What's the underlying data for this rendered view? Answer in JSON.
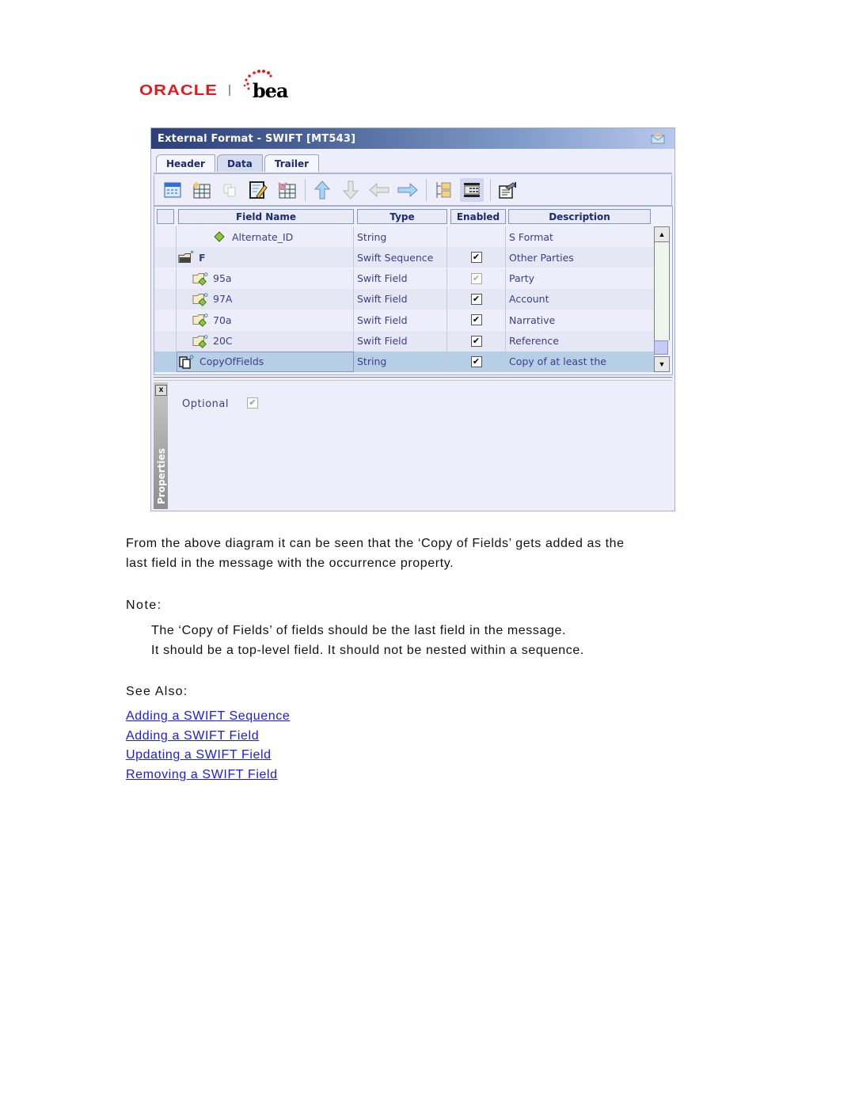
{
  "logo": {
    "oracle": "ORACLE",
    "bea": "bea"
  },
  "window": {
    "title": "External Format - SWIFT [MT543]",
    "tabs": [
      {
        "label": "Header",
        "active": false
      },
      {
        "label": "Data",
        "active": true
      },
      {
        "label": "Trailer",
        "active": false
      }
    ],
    "toolbar": [
      "properties-icon",
      "add-row-icon",
      "copy-icon",
      "edit-icon",
      "delete-row-icon",
      "move-up-icon",
      "move-down-icon",
      "move-left-icon",
      "move-right-icon",
      "tree-view-icon",
      "grid-view-icon",
      "settings-icon"
    ],
    "grid": {
      "columns": [
        "Field Name",
        "Type",
        "Enabled",
        "Description"
      ],
      "rows": [
        {
          "name": "Alternate_ID",
          "type": "String",
          "enabled": "",
          "description": "S Format",
          "icon": "diamond-icon",
          "indent": 2
        },
        {
          "name": "F",
          "type": "Swift Sequence",
          "enabled": "checked",
          "description": "Other Parties",
          "icon": "sequence-folder-icon",
          "indent": 0
        },
        {
          "name": "95a",
          "type": "Swift Field",
          "enabled": "disabled",
          "description": "Party",
          "icon": "field-folder-icon",
          "indent": 1
        },
        {
          "name": "97A",
          "type": "Swift Field",
          "enabled": "checked",
          "description": "Account",
          "icon": "field-folder-icon",
          "indent": 1
        },
        {
          "name": "70a",
          "type": "Swift Field",
          "enabled": "checked",
          "description": "Narrative",
          "icon": "field-folder-icon",
          "indent": 1
        },
        {
          "name": "20C",
          "type": "Swift Field",
          "enabled": "checked",
          "description": "Reference",
          "icon": "field-folder-icon",
          "indent": 1
        },
        {
          "name": "CopyOfFields",
          "type": "String",
          "enabled": "checked",
          "description": "Copy of at least the",
          "icon": "copy-fields-icon",
          "indent": 0,
          "selected": true
        }
      ]
    },
    "properties": {
      "panel_label": "Properties",
      "close_label": "x",
      "optional_label": "Optional",
      "check_mark": "✔"
    }
  },
  "text": {
    "para1_line1": "From the above diagram it can be seen that the ‘Copy of Fields’ gets added as the",
    "para1_line2": "last field in the message with the occurrence property.",
    "note_heading": "Note:",
    "note_line1": "The ‘Copy of Fields’ of fields should be the last field in the message.",
    "note_line2": "It should be a top-level field. It should not be nested within a sequence.",
    "see_also": "See Also:",
    "links": [
      "Adding a SWIFT Sequence",
      "Adding a SWIFT Field",
      "Updating a SWIFT Field",
      "Removing a SWIFT Field"
    ]
  }
}
